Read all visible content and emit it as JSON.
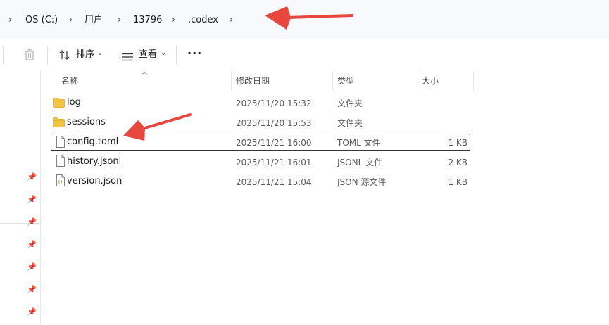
{
  "breadcrumb": {
    "items": [
      "OS (C:)",
      "用户",
      "13796",
      ".codex"
    ]
  },
  "toolbar": {
    "sort_label": "排序",
    "view_label": "查看",
    "more_label": "···"
  },
  "columns": {
    "name": "名称",
    "modified": "修改日期",
    "type": "类型",
    "size": "大小"
  },
  "files": [
    {
      "name": "log",
      "modified": "2025/11/20 15:32",
      "type": "文件夹",
      "size": "",
      "icon": "folder-icon"
    },
    {
      "name": "sessions",
      "modified": "2025/11/20 15:53",
      "type": "文件夹",
      "size": "",
      "icon": "folder-icon"
    },
    {
      "name": "config.toml",
      "modified": "2025/11/21 16:00",
      "type": "TOML 文件",
      "size": "1 KB",
      "icon": "file-icon",
      "selected": true
    },
    {
      "name": "history.jsonl",
      "modified": "2025/11/21 16:01",
      "type": "JSONL 文件",
      "size": "2 KB",
      "icon": "file-icon"
    },
    {
      "name": "version.json",
      "modified": "2025/11/21 15:04",
      "type": "JSON 源文件",
      "size": "1 KB",
      "icon": "json-file-icon"
    }
  ],
  "colors": {
    "folder": "#f5c542",
    "annotation_arrow": "#e8473e",
    "address_bg": "#f7f9fc"
  }
}
